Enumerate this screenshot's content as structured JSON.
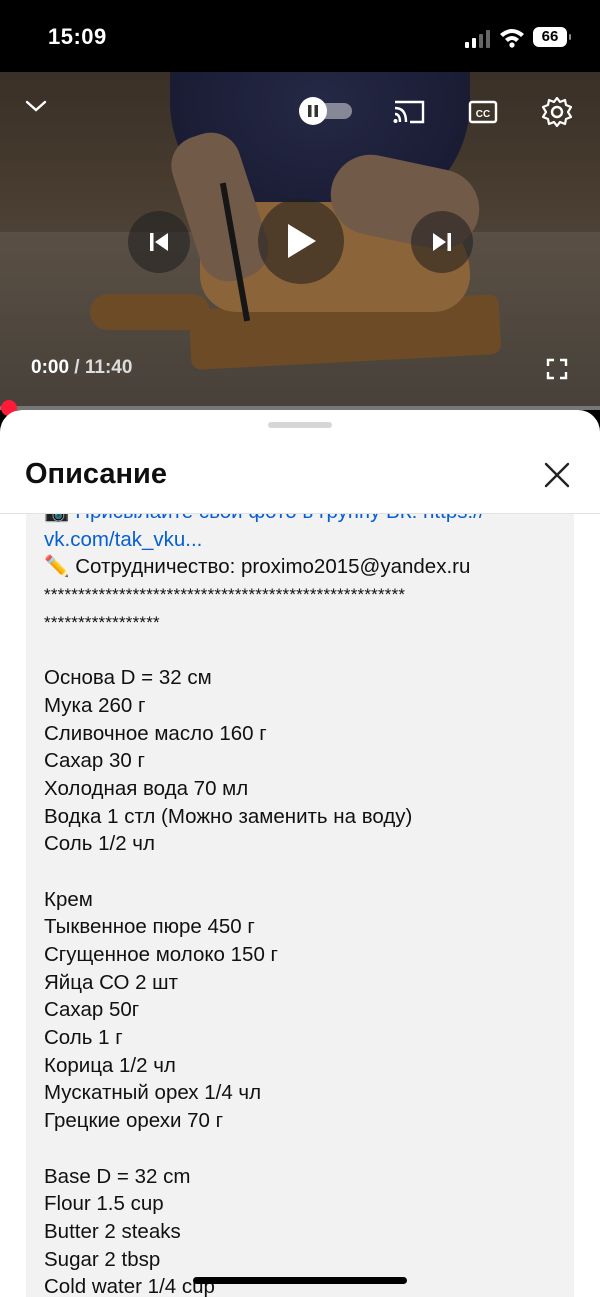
{
  "status_bar": {
    "time": "15:09",
    "battery": "66",
    "icons": [
      "signal-icon",
      "wifi-icon",
      "battery-icon"
    ]
  },
  "player": {
    "current_time": "0:00",
    "separator": " / ",
    "duration": "11:40",
    "progress": 0.0,
    "controls": [
      "chevron-down-icon",
      "autoplay-toggle",
      "cast-icon",
      "captions-icon",
      "settings-icon",
      "previous-icon",
      "play-icon",
      "next-icon",
      "fullscreen-icon"
    ],
    "accent_color": "#ff0033"
  },
  "sheet": {
    "title": "Описание"
  },
  "description": {
    "partial_line": "📷 Присылайте свои фото в группу ВК: https://",
    "link_line": "vk.com/tak_vku...",
    "cooperation": "✏️ Сотрудничество: proximo2015@yandex.ru",
    "stars_1": "*****************************************************",
    "stars_2": "*****************",
    "base_ru": [
      "Основа D = 32 см",
      "Мука 260 г",
      "Сливочное масло 160 г",
      "Сахар 30 г",
      "Холодная вода 70 мл",
      "Водка 1 стл (Можно заменить на воду)",
      "Соль 1/2 чл"
    ],
    "cream_ru": [
      "Крем",
      "Тыквенное пюре 450 г",
      "Сгущенное молоко 150 г",
      "Яйца СО 2 шт",
      "Сахар 50г",
      "Соль 1 г",
      "Корица 1/2 чл",
      "Мускатный орех 1/4 чл",
      "Грецкие орехи 70 г"
    ],
    "base_en": [
      "Base D = 32 cm",
      "Flour 1.5 cup",
      "Butter 2 steaks",
      "Sugar 2 tbsp",
      "Cold water 1/4 cup"
    ]
  }
}
